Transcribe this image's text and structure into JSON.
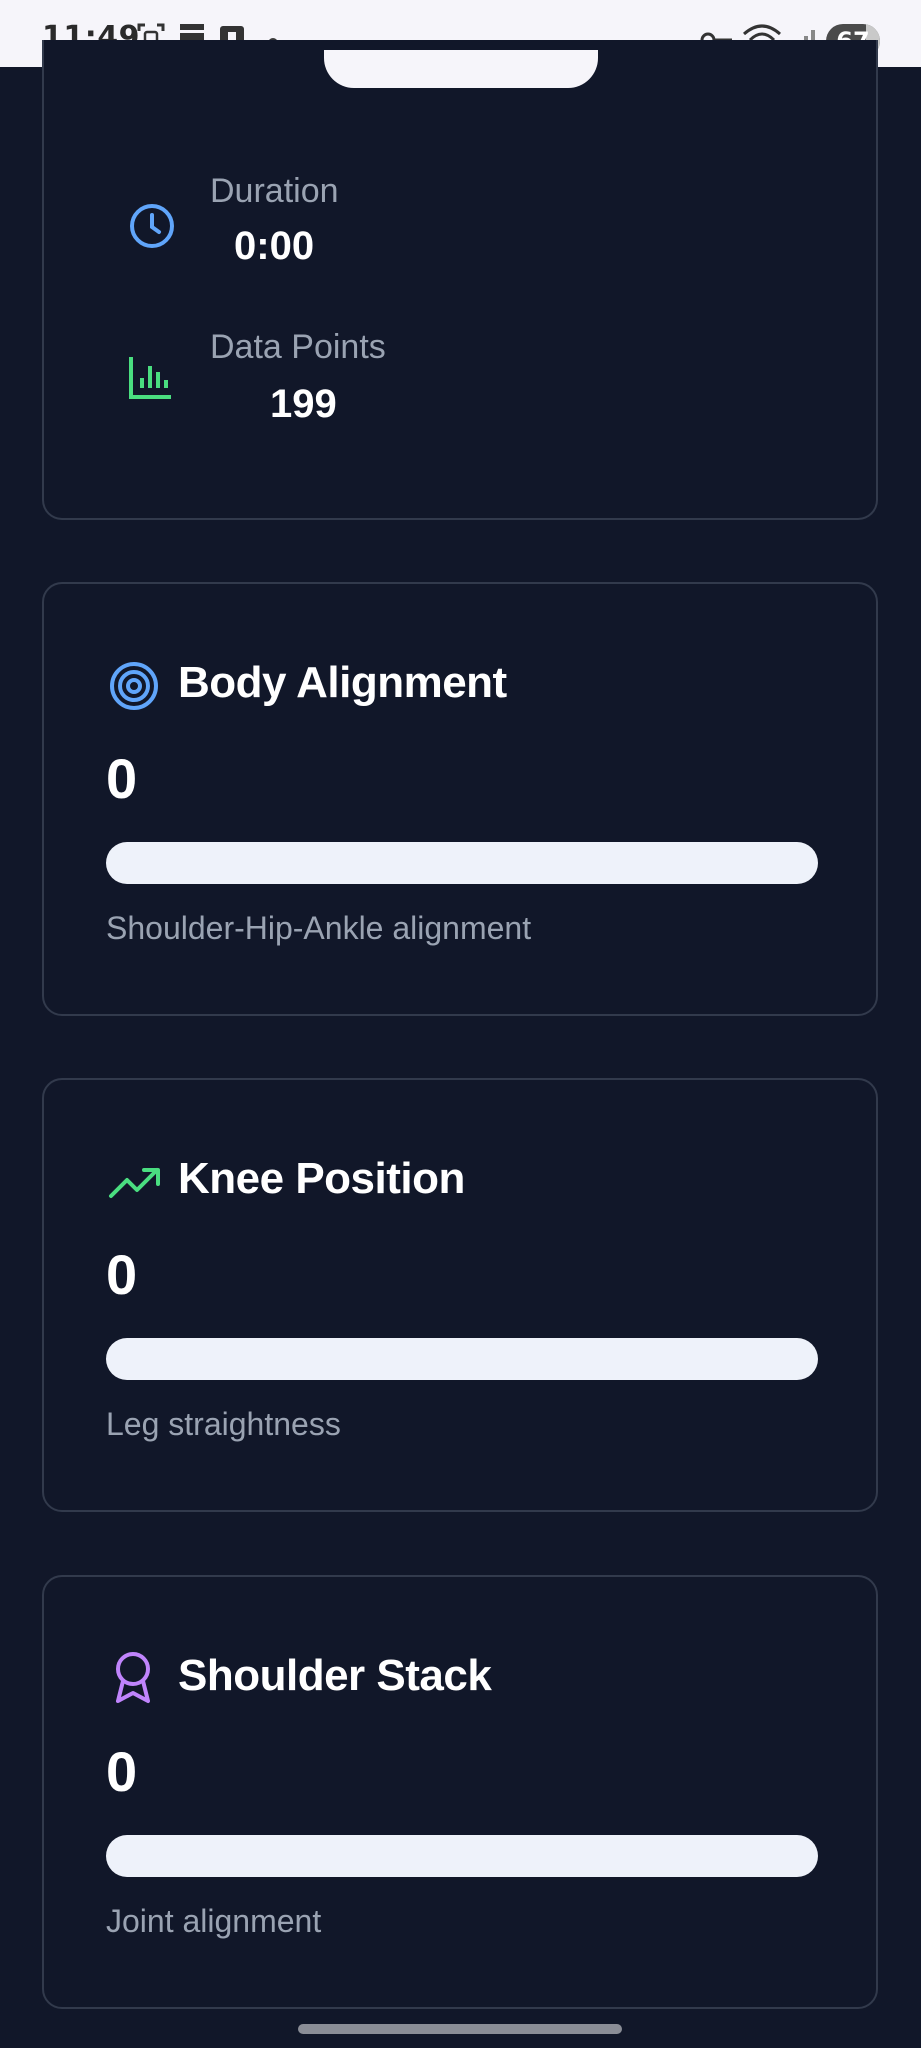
{
  "status_bar": {
    "time": "11:49",
    "battery": "67",
    "icons": [
      "screenshot-icon",
      "bookmark-icon",
      "notification-app-icon",
      "key-icon",
      "wifi-icon",
      "signal-icon"
    ]
  },
  "session_stats": {
    "duration": {
      "label": "Duration",
      "value": "0:00",
      "icon": "clock-icon"
    },
    "data_points": {
      "label": "Data Points",
      "value": "199",
      "icon": "bar-chart-icon"
    }
  },
  "metrics": [
    {
      "title": "Body Alignment",
      "value": "0",
      "progress": 0,
      "description": "Shoulder-Hip-Ankle alignment",
      "icon": "target-icon",
      "icon_color": "#60a5fa"
    },
    {
      "title": "Knee Position",
      "value": "0",
      "progress": 0,
      "description": "Leg straightness",
      "icon": "trending-up-icon",
      "icon_color": "#4ade80"
    },
    {
      "title": "Shoulder Stack",
      "value": "0",
      "progress": 0,
      "description": "Joint alignment",
      "icon": "award-icon",
      "icon_color": "#c084fc"
    }
  ],
  "colors": {
    "background": "#111729",
    "card_border": "#323a4c",
    "muted_text": "#9aa3b2",
    "track": "#eef2fa"
  }
}
